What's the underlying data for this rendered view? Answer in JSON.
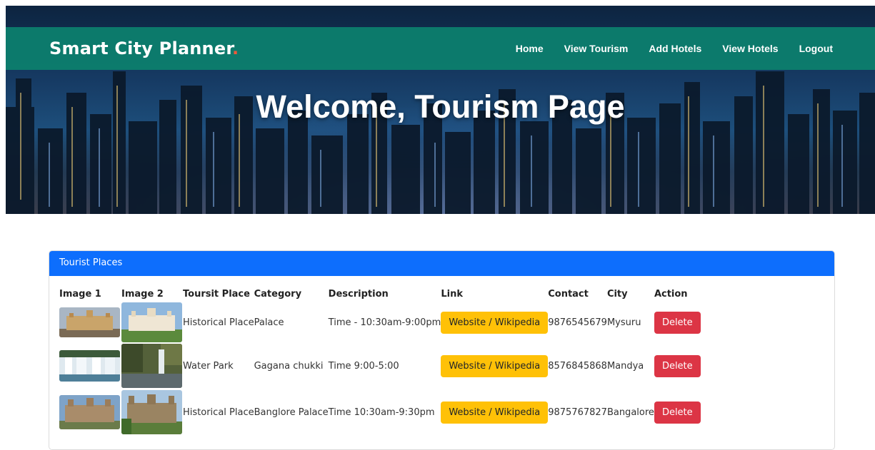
{
  "navbar": {
    "brand": "Smart City Planner",
    "brand_dot": ".",
    "links": [
      "Home",
      "View Tourism",
      "Add Hotels",
      "View Hotels",
      "Logout"
    ]
  },
  "hero": {
    "title": "Welcome, Tourism Page"
  },
  "card": {
    "header": "Tourist Places",
    "columns": [
      "Image 1",
      "Image 2",
      "Toursit Place",
      "Category",
      "Description",
      "Link",
      "Contact",
      "City",
      "Action"
    ],
    "rows": [
      {
        "place": "Historical Place",
        "category": "Palace",
        "description": "Time - 10:30am-9:00pm",
        "link_label": "Website / Wikipedia",
        "contact": "9876545679",
        "city": "Mysuru",
        "action_label": "Delete"
      },
      {
        "place": "Water Park",
        "category": "Gagana chukki",
        "description": "Time 9:00-5:00",
        "link_label": "Website / Wikipedia",
        "contact": "8576845868",
        "city": "Mandya",
        "action_label": "Delete"
      },
      {
        "place": "Historical Place",
        "category": "Banglore Palace",
        "description": "Time 10:30am-9:30pm",
        "link_label": "Website / Wikipedia",
        "contact": "9875767827",
        "city": "Bangalore",
        "action_label": "Delete"
      }
    ]
  },
  "colors": {
    "navbar": "#0c806e",
    "brand_dot": "#f0593a",
    "card_header": "#0d6efd",
    "link_button": "#ffc107",
    "delete_button": "#dc3545"
  }
}
